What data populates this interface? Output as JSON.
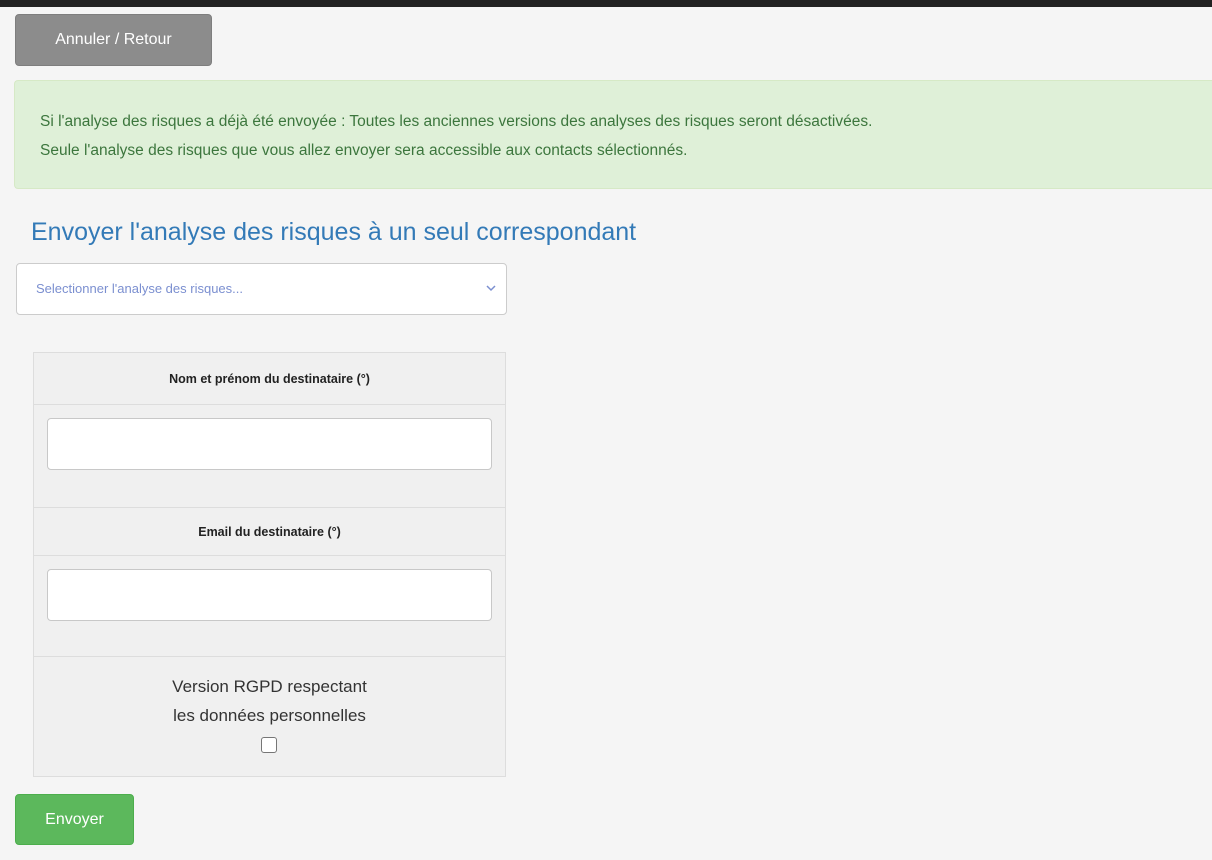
{
  "toolbar": {
    "back_label": "Annuler / Retour"
  },
  "alert": {
    "line1": "Si l'analyse des risques a déjà été envoyée : Toutes les anciennes versions des analyses des risques seront désactivées.",
    "line2": "Seule l'analyse des risques que vous allez envoyer sera accessible aux contacts sélectionnés."
  },
  "section": {
    "title": "Envoyer l'analyse des risques à un seul correspondant"
  },
  "select": {
    "placeholder": "Selectionner l'analyse des risques...",
    "icon": "chevron-down-icon"
  },
  "form": {
    "name_header": "Nom et prénom du destinataire (°)",
    "name_value": "",
    "email_header": "Email du destinataire (°)",
    "email_value": "",
    "rgpd_line1": "Version RGPD respectant",
    "rgpd_line2": "les données personnelles",
    "rgpd_checked": false
  },
  "actions": {
    "send_label": "Envoyer"
  },
  "colors": {
    "back_button": "#8c8c8c",
    "alert_bg": "#dff0d8",
    "alert_text": "#3c763d",
    "title": "#337ab7",
    "send_button": "#5cb85c"
  }
}
